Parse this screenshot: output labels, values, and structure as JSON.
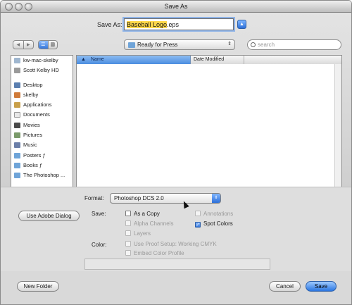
{
  "window": {
    "title": "Save As"
  },
  "saveas": {
    "label": "Save As:",
    "filename_selected": "Baseball Logo",
    "filename_ext": ".eps"
  },
  "toolbar": {
    "back_glyph": "◀",
    "forward_glyph": "▶",
    "location": "Ready for Press",
    "search_placeholder": "search"
  },
  "sidebar": {
    "devices": [
      {
        "label": "kw-mac-skelby",
        "icon": "computer-icon"
      },
      {
        "label": "Scott Kelby HD",
        "icon": "harddisk-icon"
      }
    ],
    "places": [
      {
        "label": "Desktop",
        "icon": "desktop-icon"
      },
      {
        "label": "skelby",
        "icon": "home-icon"
      },
      {
        "label": "Applications",
        "icon": "applications-icon"
      },
      {
        "label": "Documents",
        "icon": "documents-icon"
      },
      {
        "label": "Movies",
        "icon": "movies-icon"
      },
      {
        "label": "Pictures",
        "icon": "pictures-icon"
      },
      {
        "label": "Music",
        "icon": "music-icon"
      },
      {
        "label": "Posters ƒ",
        "icon": "folder-icon"
      },
      {
        "label": "Books ƒ",
        "icon": "folder-icon"
      },
      {
        "label": "The Photoshop ...",
        "icon": "folder-icon"
      }
    ]
  },
  "browser": {
    "col_name": "Name",
    "col_date": "Date Modified"
  },
  "options": {
    "format_label": "Format:",
    "format_value": "Photoshop DCS 2.0",
    "use_adobe_dialog": "Use Adobe Dialog",
    "save_label": "Save:",
    "as_a_copy": "As a Copy",
    "annotations": "Annotations",
    "alpha_channels": "Alpha Channels",
    "spot_colors": "Spot Colors",
    "layers": "Layers",
    "color_label": "Color:",
    "use_proof_setup": "Use Proof Setup:  Working CMYK",
    "embed_color_profile": "Embed Color Profile"
  },
  "buttons": {
    "new_folder": "New Folder",
    "cancel": "Cancel",
    "save": "Save"
  },
  "colors": {
    "accent": "#3677d9",
    "highlight": "#ffd84a"
  }
}
